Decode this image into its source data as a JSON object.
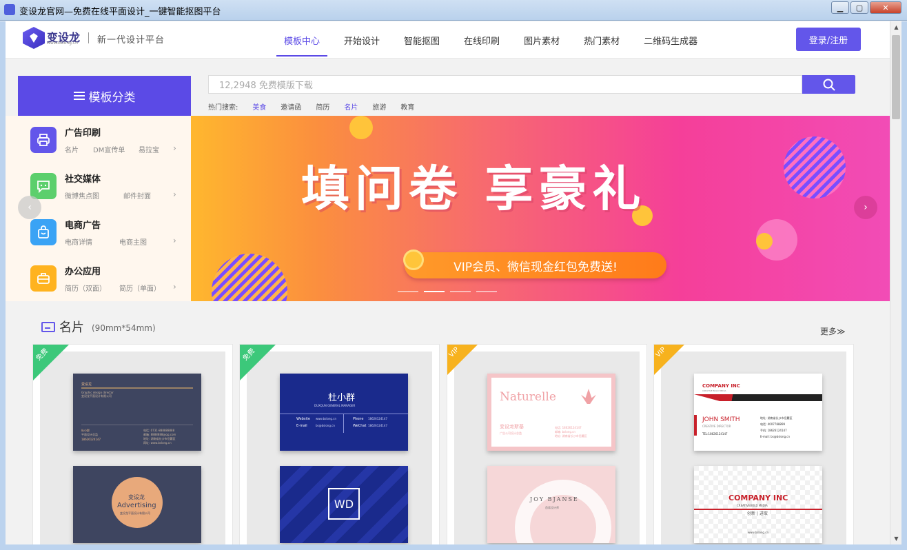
{
  "window": {
    "title": "变设龙官网—免费在线平面设计_一键智能抠图平台",
    "min_label": "▁",
    "max_label": "▢",
    "close_label": "✕"
  },
  "header": {
    "logo_text": "变设龙",
    "logo_url": "www.bslong.cn",
    "slogan": "新一代设计平台",
    "nav": [
      "模板中心",
      "开始设计",
      "智能抠图",
      "在线印刷",
      "图片素材",
      "热门素材",
      "二维码生成器"
    ],
    "active_nav": "模板中心",
    "login_label": "登录/注册"
  },
  "category": {
    "title": "模板分类",
    "items": [
      {
        "title": "广告印刷",
        "subs": [
          "名片",
          "DM宣传单",
          "易拉宝"
        ],
        "color": "#6356ea",
        "icon": "printer-icon"
      },
      {
        "title": "社交媒体",
        "subs": [
          "微博焦点图",
          "邮件封面"
        ],
        "color": "#5ccf6c",
        "icon": "chat-icon"
      },
      {
        "title": "电商广告",
        "subs": [
          "电商详情",
          "电商主图"
        ],
        "color": "#3aa3f5",
        "icon": "shopping-bag-icon"
      },
      {
        "title": "办公应用",
        "subs": [
          "简历（双面）",
          "简历（单面）"
        ],
        "color": "#ffb31f",
        "icon": "briefcase-icon"
      }
    ]
  },
  "search": {
    "placeholder": "12,2948 免费模版下载",
    "hot_label": "热门搜索:",
    "hot_terms": [
      "美食",
      "邀请函",
      "简历",
      "名片",
      "旅游",
      "教育"
    ],
    "highlighted_terms": [
      "美食",
      "名片"
    ]
  },
  "banner": {
    "title": "填问卷 享豪礼",
    "pill": "VIP会员、微信现金红包免费送!",
    "slides": 4,
    "active_slide": 2
  },
  "section": {
    "title": "名片",
    "subtitle": "(90mm*54mm)",
    "more_label": "更多≫"
  },
  "cards": [
    {
      "badge": "免费",
      "badge_color": "#3cc87a",
      "top": {
        "lines": [
          "变设龙",
          "Graphic design director",
          "变设龙平面设计有限公司",
          "杜小群",
          "平面设计总监",
          "18626124147",
          "电话: 0731-888888888",
          "邮箱: 8888888@qq.com",
          "地址: 湖南省长沙市岳麓区",
          "网址: www.bslong.cn"
        ]
      },
      "bottom": {
        "logo": "变设龙",
        "word": "Advertising",
        "small": "变设龙平面设计有限公司"
      }
    },
    {
      "badge": "免费",
      "badge_color": "#3cc87a",
      "top": {
        "name": "杜小群",
        "role": "DUXQUN GENERAL MANAGER",
        "rows": [
          "Website",
          "www.bslong.cn",
          "Phone",
          "18626124147",
          "E-mail",
          "bs@bslong.cn",
          "WeChat",
          "18626124147"
        ]
      },
      "bottom": {
        "mark": "WD"
      }
    },
    {
      "badge": "VIP",
      "badge_color": "#f7b21e",
      "top": {
        "brand": "Naturelle",
        "company": "变设龙斯基",
        "lines": [
          "电话: 18626124147",
          "邮箱: bslong.cn",
          "地址: 湖南省长沙市岳麓区",
          "广告公司设计总监"
        ]
      },
      "bottom": {
        "name": "JOY BJANSE",
        "small": "首席设计师"
      }
    },
    {
      "badge": "VIP",
      "badge_color": "#f7b21e",
      "top": {
        "company": "COMPANY INC",
        "tagline": "CREATIVE BOLD MEDIA",
        "name": "JOHN SMITH",
        "role": "CREATIVE DIRECTOR",
        "phone": "TEL:18626124147",
        "rows": [
          "地址: 湖南省长沙市岳麓区",
          "电话: 4007788899",
          "手机: 18626124147",
          "E-mail: bs@bslong.cn"
        ]
      },
      "bottom": {
        "company": "COMPANY INC",
        "tagline": "CREATIVEBOLD MEDIA",
        "cn": "创新 | 进取",
        "url": "www.bslong.cn"
      }
    }
  ],
  "colors": {
    "accent": "#5b4ae6",
    "button": "#6356ea"
  }
}
